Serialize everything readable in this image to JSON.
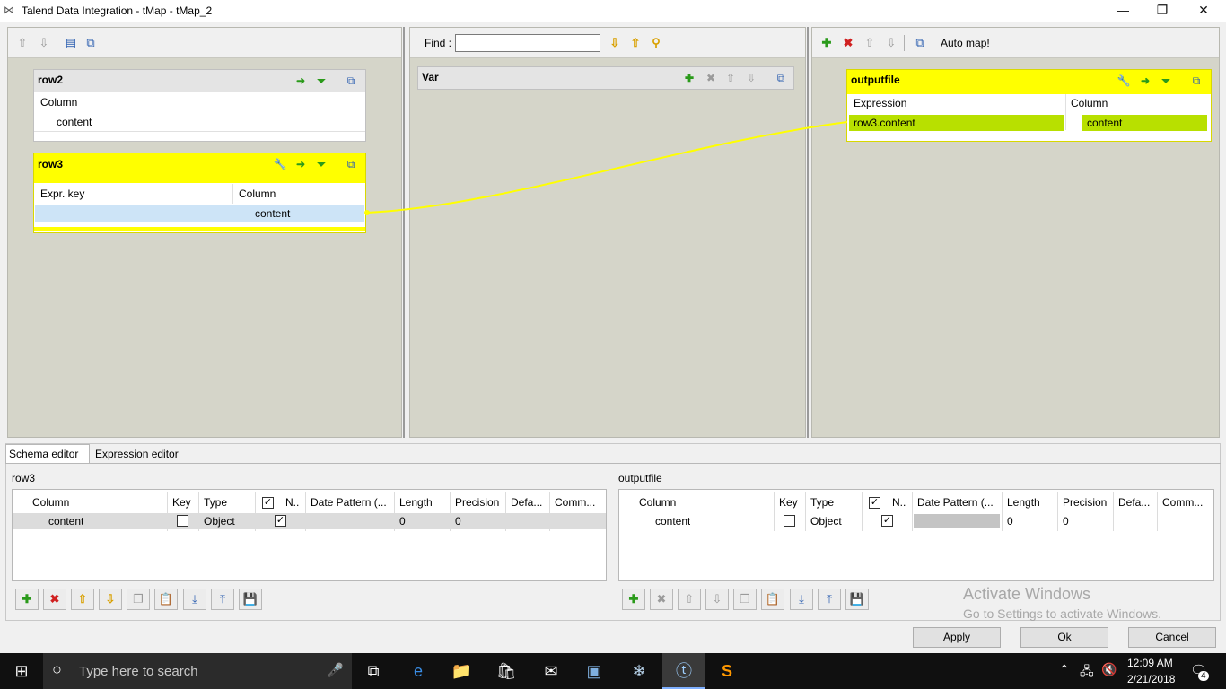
{
  "window": {
    "title": "Talend Data Integration - tMap - tMap_2",
    "minimize": "—",
    "maximize": "❐",
    "close": "✕"
  },
  "input_pane": {
    "tables": [
      {
        "name": "row2",
        "col_header": "Column",
        "rows": [
          "content"
        ]
      },
      {
        "name": "row3",
        "key_header": "Expr. key",
        "col_header": "Column",
        "rows": [
          "content"
        ]
      }
    ]
  },
  "var_pane": {
    "find_label": "Find :",
    "find_value": "",
    "table_name": "Var"
  },
  "output_pane": {
    "auto_map_label": "Auto map!",
    "table": {
      "name": "outputfile",
      "expr_header": "Expression",
      "col_header": "Column",
      "rows": [
        {
          "expression": "row3.content",
          "column": "content"
        }
      ]
    }
  },
  "bottom": {
    "tabs": [
      "Schema editor",
      "Expression editor"
    ],
    "left": {
      "title": "row3",
      "headers": [
        "Column",
        "Key",
        "Type",
        "N..",
        "Date Pattern (...",
        "Length",
        "Precision",
        "Defa...",
        "Comm..."
      ],
      "row": {
        "column": "content",
        "type": "Object",
        "length": "0",
        "precision": "0"
      }
    },
    "right": {
      "title": "outputfile",
      "headers": [
        "Column",
        "Key",
        "Type",
        "N..",
        "Date Pattern (...",
        "Length",
        "Precision",
        "Defa...",
        "Comm..."
      ],
      "row": {
        "column": "content",
        "type": "Object",
        "length": "0",
        "precision": "0"
      }
    }
  },
  "watermark": {
    "line1": "Activate Windows",
    "line2": "Go to Settings to activate Windows."
  },
  "buttons": {
    "apply": "Apply",
    "ok": "Ok",
    "cancel": "Cancel"
  },
  "taskbar": {
    "search_placeholder": "Type here to search",
    "time": "12:09 AM",
    "date": "2/21/2018",
    "notifications": "4"
  }
}
